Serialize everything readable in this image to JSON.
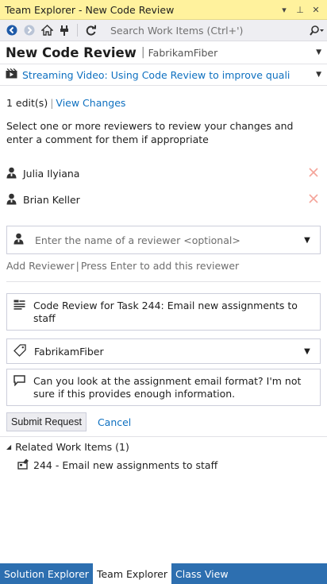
{
  "window": {
    "title": "Team Explorer - New Code Review",
    "controls": {
      "dropdown": "▾",
      "pin": "⊥",
      "close": "✕"
    }
  },
  "toolbar": {
    "search_placeholder": "Search Work Items (Ctrl+')",
    "icons": [
      "back-icon",
      "forward-icon",
      "home-icon",
      "connect-icon",
      "refresh-icon",
      "search-icon"
    ]
  },
  "page": {
    "title": "New Code Review",
    "separator": "|",
    "project": "FabrikamFiber"
  },
  "video": {
    "link": "Streaming Video: Using Code Review to improve quali"
  },
  "edits": {
    "count_text": "1 edit(s)",
    "separator": "|",
    "view_changes": "View Changes"
  },
  "instructions": "Select one or more reviewers to review your changes and enter a comment for them if appropriate",
  "reviewers": [
    {
      "name": "Julia Ilyiana"
    },
    {
      "name": "Brian Keller"
    }
  ],
  "add_reviewer": {
    "placeholder": "Enter the name of a reviewer <optional>",
    "link": "Add Reviewer",
    "separator": "|",
    "hint": "Press Enter to add this reviewer"
  },
  "review": {
    "title": "Code Review for Task 244: Email new assignments to staff",
    "area": "FabrikamFiber",
    "comment": "Can you look at the assignment email format? I'm not sure if this provides enough information."
  },
  "actions": {
    "submit": "Submit Request",
    "cancel": "Cancel"
  },
  "related": {
    "header": "Related Work Items (1)",
    "items": [
      {
        "label": "244 - Email new assignments to staff"
      }
    ]
  },
  "bottom_tabs": [
    {
      "label": "Solution Explorer",
      "active": false
    },
    {
      "label": "Team Explorer",
      "active": true
    },
    {
      "label": "Class View",
      "active": false
    }
  ],
  "colors": {
    "titlebar": "#fff29d",
    "link": "#0e70c0",
    "tabbar": "#2d6fb0",
    "remove_x": "#f4a49a"
  }
}
